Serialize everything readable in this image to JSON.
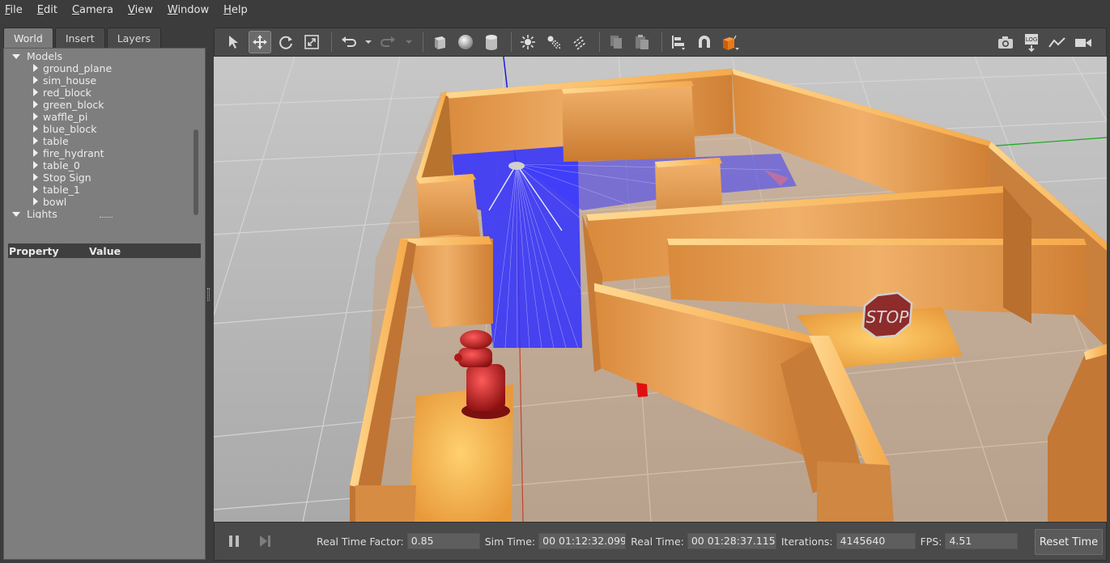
{
  "menu": [
    "File",
    "Edit",
    "Camera",
    "View",
    "Window",
    "Help"
  ],
  "menu_mnemonic_index": [
    0,
    0,
    0,
    0,
    0,
    0
  ],
  "tabs": [
    "World",
    "Insert",
    "Layers"
  ],
  "active_tab": "World",
  "tree": {
    "models_label": "Models",
    "models": [
      "ground_plane",
      "sim_house",
      "red_block",
      "green_block",
      "waffle_pi",
      "blue_block",
      "table",
      "fire_hydrant",
      "table_0",
      "Stop Sign",
      "table_1",
      "bowl"
    ],
    "lights_label": "Lights"
  },
  "properties": {
    "col_property": "Property",
    "col_value": "Value"
  },
  "toolbar": {
    "icons": [
      "select-arrow-icon",
      "translate-icon",
      "rotate-icon",
      "scale-icon",
      "undo-icon",
      "undo-dropdown-icon",
      "redo-icon",
      "redo-dropdown-icon",
      "box-shape-icon",
      "sphere-shape-icon",
      "cylinder-shape-icon",
      "point-light-icon",
      "spot-light-icon",
      "directional-light-icon",
      "copy-icon",
      "paste-icon",
      "align-icon",
      "snap-magnet-icon",
      "view-angle-icon"
    ],
    "right_icons": [
      "screenshot-icon",
      "log-icon",
      "plot-icon",
      "record-video-icon"
    ],
    "log_text": "LOG"
  },
  "status": {
    "rtf_label": "Real Time Factor:",
    "rtf_value": "0.85",
    "sim_label": "Sim Time:",
    "sim_value": "00 01:12:32.099",
    "real_label": "Real Time:",
    "real_value": "00 01:28:37.115",
    "iter_label": "Iterations:",
    "iter_value": "4145640",
    "fps_label": "FPS:",
    "fps_value": "4.51",
    "reset_label": "Reset Time"
  },
  "scene": {
    "stop_sign_text": "STOP"
  },
  "colors": {
    "panel": "#7e7e7e",
    "toolbar": "#4a4a4a",
    "wood": "#e8a45a",
    "laser": "#2020ff",
    "hydrant": "#c81e1e",
    "stop": "#9a2a2a"
  }
}
